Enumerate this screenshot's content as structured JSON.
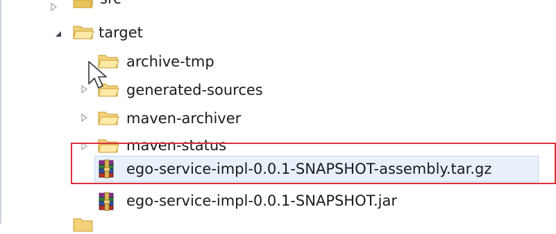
{
  "tree": {
    "items": [
      {
        "label": "src",
        "kind": "folder",
        "expanded": false
      },
      {
        "label": "target",
        "kind": "folder",
        "expanded": true
      },
      {
        "label": "archive-tmp",
        "kind": "folder",
        "expanded": false
      },
      {
        "label": "generated-sources",
        "kind": "folder",
        "expanded": false
      },
      {
        "label": "maven-archiver",
        "kind": "folder",
        "expanded": false
      },
      {
        "label": "maven-status",
        "kind": "folder",
        "expanded": false
      },
      {
        "label": "ego-service-impl-0.0.1-SNAPSHOT-assembly.tar.gz",
        "kind": "archive",
        "selected": true,
        "highlighted": true
      },
      {
        "label": "ego-service-impl-0.0.1-SNAPSHOT.jar",
        "kind": "archive"
      }
    ]
  },
  "colors": {
    "folder": "#e8c35a",
    "folder_dark": "#c99a2e",
    "selection": "#e8f1fb",
    "highlight_box": "#d9303a"
  },
  "icons": {
    "folder": "folder-icon",
    "archive": "winrar-archive-icon",
    "expand": "expand-arrow-icon",
    "collapse": "collapse-arrow-icon"
  }
}
